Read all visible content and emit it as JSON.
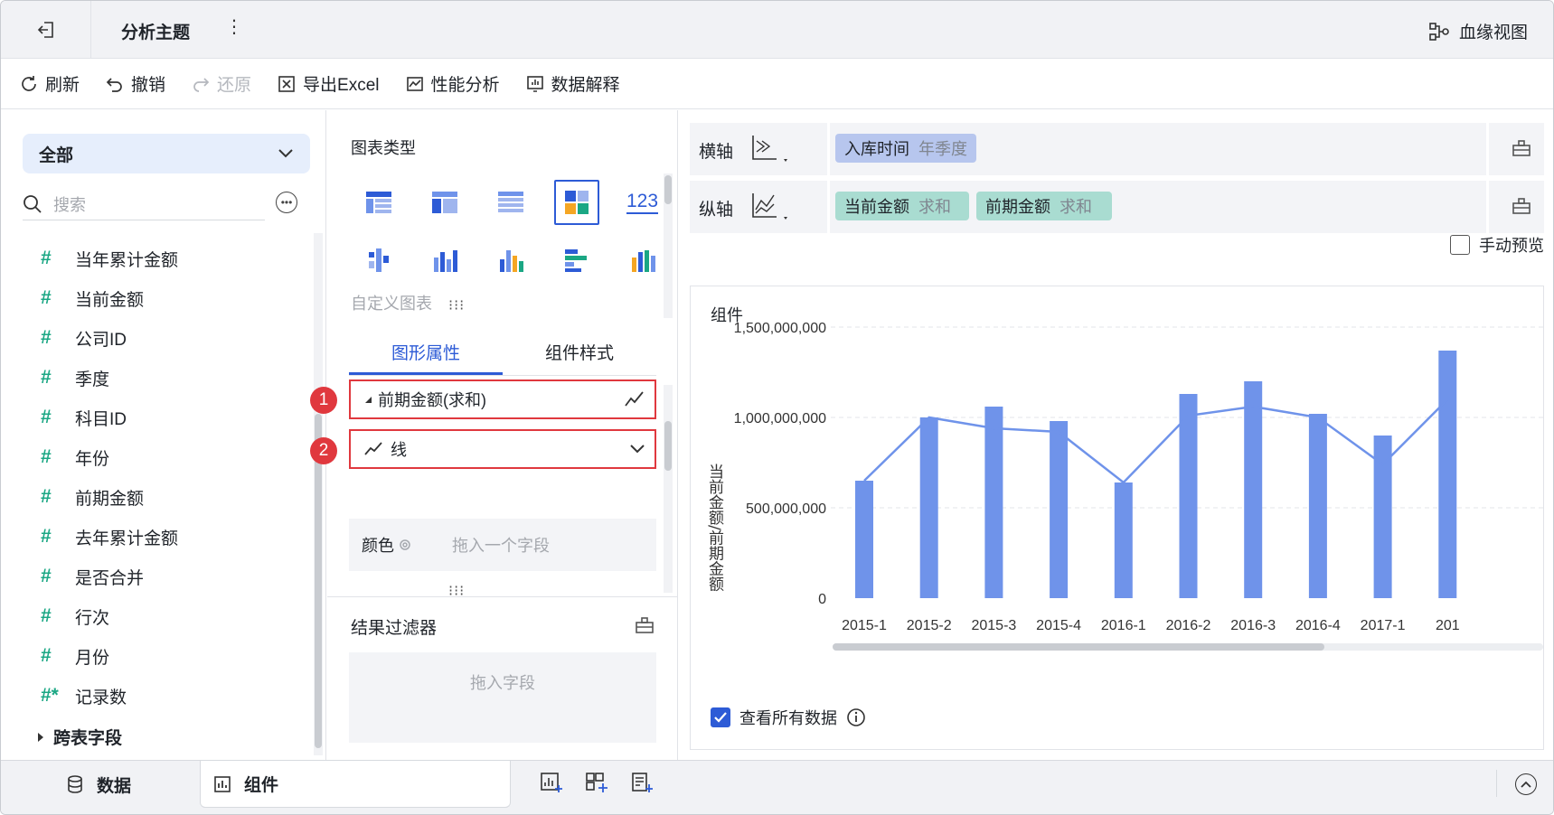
{
  "header": {
    "title": "分析主题",
    "more": "⋮",
    "lineage_label": "血缘视图"
  },
  "toolbar": {
    "refresh": "刷新",
    "undo": "撤销",
    "redo": "还原",
    "export": "导出Excel",
    "perf": "性能分析",
    "explain": "数据解释"
  },
  "left": {
    "scope": "全部",
    "search_placeholder": "搜索",
    "fields": [
      {
        "label": "当年累计金额",
        "symbol": "#"
      },
      {
        "label": "当前金额",
        "symbol": "#"
      },
      {
        "label": "公司ID",
        "symbol": "#"
      },
      {
        "label": "季度",
        "symbol": "#"
      },
      {
        "label": "科目ID",
        "symbol": "#"
      },
      {
        "label": "年份",
        "symbol": "#"
      },
      {
        "label": "前期金额",
        "symbol": "#"
      },
      {
        "label": "去年累计金额",
        "symbol": "#"
      },
      {
        "label": "是否合并",
        "symbol": "#"
      },
      {
        "label": "行次",
        "symbol": "#"
      },
      {
        "label": "月份",
        "symbol": "#"
      },
      {
        "label": "记录数",
        "symbol": "#*"
      }
    ],
    "cross_table": "跨表字段"
  },
  "middle": {
    "chart_type_label": "图表类型",
    "chart_type_third_row1": "123",
    "custom_chart": "自定义图表",
    "tabs": [
      "图形属性",
      "组件样式"
    ],
    "property_series": "前期金额(求和)",
    "property_shape": "线",
    "badge1": "1",
    "badge2": "2",
    "color_label": "颜色",
    "color_placeholder": "拖入一个字段",
    "filter_label": "结果过滤器",
    "filter_placeholder": "拖入字段"
  },
  "right": {
    "x_axis_label": "横轴",
    "y_axis_label": "纵轴",
    "x_pill": {
      "name": "入库时间",
      "agg": "年季度"
    },
    "y_pills": [
      {
        "name": "当前金额",
        "agg": "求和"
      },
      {
        "name": "前期金额",
        "agg": "求和"
      }
    ],
    "manual_preview": "手动预览",
    "widget_title": "组件",
    "view_all": "查看所有数据"
  },
  "bottom": {
    "data_tab": "数据",
    "widget_tab": "组件"
  },
  "colors": {
    "accent": "#2d5bd6",
    "bar": "#6f93ea",
    "line": "#6f93ea",
    "highlight_red": "#e0383e",
    "field_green": "#1ba784"
  },
  "chart_data": {
    "type": "bar",
    "categories": [
      "2015-1",
      "2015-2",
      "2015-3",
      "2015-4",
      "2016-1",
      "2016-2",
      "2016-3",
      "2016-4",
      "2017-1",
      "201"
    ],
    "y_ticks": [
      "0",
      "500,000,000",
      "1,000,000,000",
      "1,500,000,000"
    ],
    "ylabel": "当前金额/前期金额",
    "ylim": [
      0,
      1500000000
    ],
    "grid": true,
    "series": [
      {
        "name": "当前金额",
        "type": "bar",
        "values": [
          650000000,
          1000000000,
          1060000000,
          980000000,
          640000000,
          1130000000,
          1200000000,
          1020000000,
          900000000,
          1370000000
        ]
      },
      {
        "name": "前期金额",
        "type": "line",
        "values": [
          650000000,
          1000000000,
          940000000,
          920000000,
          640000000,
          1010000000,
          1060000000,
          1000000000,
          740000000,
          1100000000
        ]
      }
    ]
  }
}
